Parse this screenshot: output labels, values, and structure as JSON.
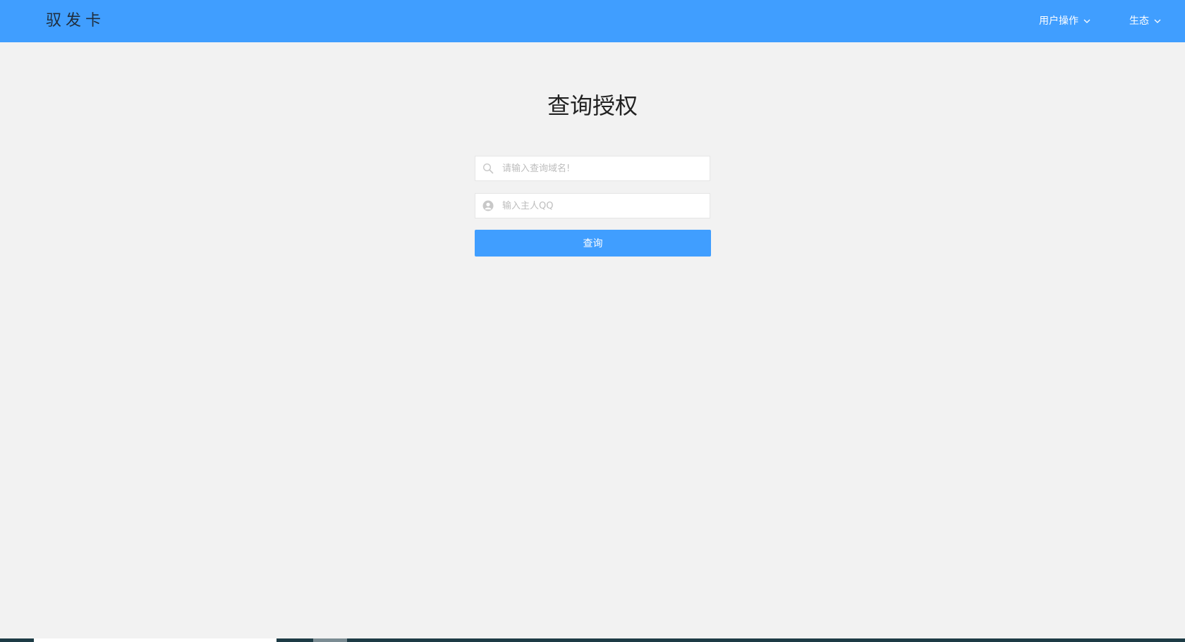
{
  "header": {
    "logo": "驭发卡",
    "nav": [
      {
        "label": "用户操作",
        "icon": "chevron-down-icon"
      },
      {
        "label": "生态",
        "icon": "chevron-down-icon"
      }
    ]
  },
  "main": {
    "title": "查询授权",
    "domain_input": {
      "placeholder": "请输入查询域名!",
      "value": "",
      "icon": "search-icon"
    },
    "qq_input": {
      "placeholder": "输入主人QQ",
      "value": "",
      "icon": "user-icon"
    },
    "submit_label": "查询"
  },
  "colors": {
    "primary": "#409eff",
    "background": "#f2f2f2",
    "input_border": "#e6e6e6"
  }
}
